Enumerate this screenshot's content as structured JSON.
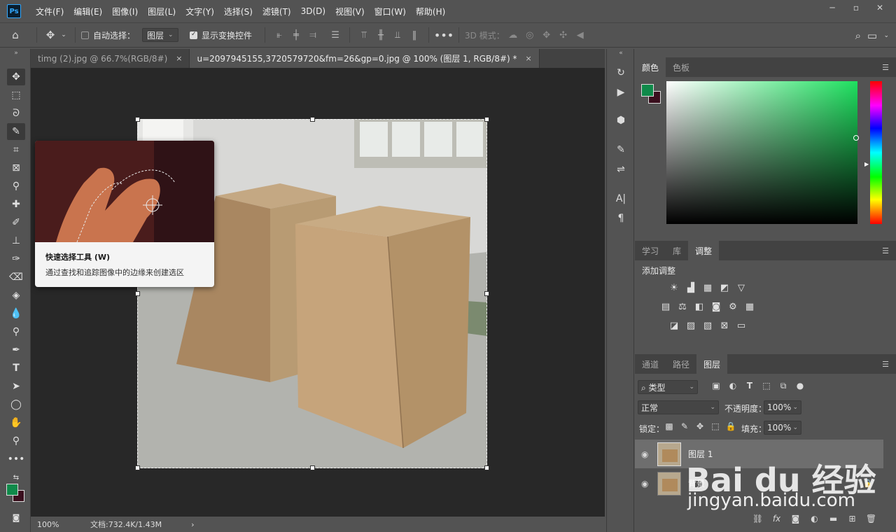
{
  "menubar": {
    "items": [
      "文件(F)",
      "编辑(E)",
      "图像(I)",
      "图层(L)",
      "文字(Y)",
      "选择(S)",
      "滤镜(T)",
      "3D(D)",
      "视图(V)",
      "窗口(W)",
      "帮助(H)"
    ],
    "logo_text": "Ps"
  },
  "options": {
    "auto_select_label": "自动选择：",
    "auto_select_value": "图层",
    "show_transform_label": "显示变换控件",
    "mode_3d_label": "3D 模式："
  },
  "tabs": [
    {
      "label": "timg (2).jpg @ 66.7%(RGB/8#)",
      "close": "×"
    },
    {
      "label": "u=2097945155,3720579720&fm=26&gp=0.jpg @ 100% (图层 1, RGB/8#) *",
      "close": "×"
    }
  ],
  "tooltip": {
    "title": "快速选择工具 (W)",
    "description": "通过查找和追踪图像中的边缘来创建选区"
  },
  "status": {
    "zoom": "100%",
    "doc_info": "文档:732.4K/1.43M",
    "arrow": "›"
  },
  "color_panel": {
    "tabs": [
      "颜色",
      "色板"
    ],
    "foreground": "#0f8a4a",
    "background": "#3a0f1e"
  },
  "adjust_panel": {
    "tabs": [
      "学习",
      "库",
      "调整"
    ],
    "add_label": "添加调整"
  },
  "layers_panel": {
    "tabs": [
      "通道",
      "路径",
      "图层"
    ],
    "filter_value": "类型",
    "blend_mode": "正常",
    "opacity_label": "不透明度：",
    "opacity_value": "100%",
    "lock_label": "锁定：",
    "fill_label": "填充：",
    "fill_value": "100%",
    "layers": [
      {
        "name": "图层 1",
        "locked": false,
        "selected": true
      },
      {
        "name": "背景",
        "locked": true,
        "selected": false
      }
    ]
  },
  "watermark": {
    "logo": "Bai du 经验",
    "url": "jingyan.baidu.com"
  }
}
